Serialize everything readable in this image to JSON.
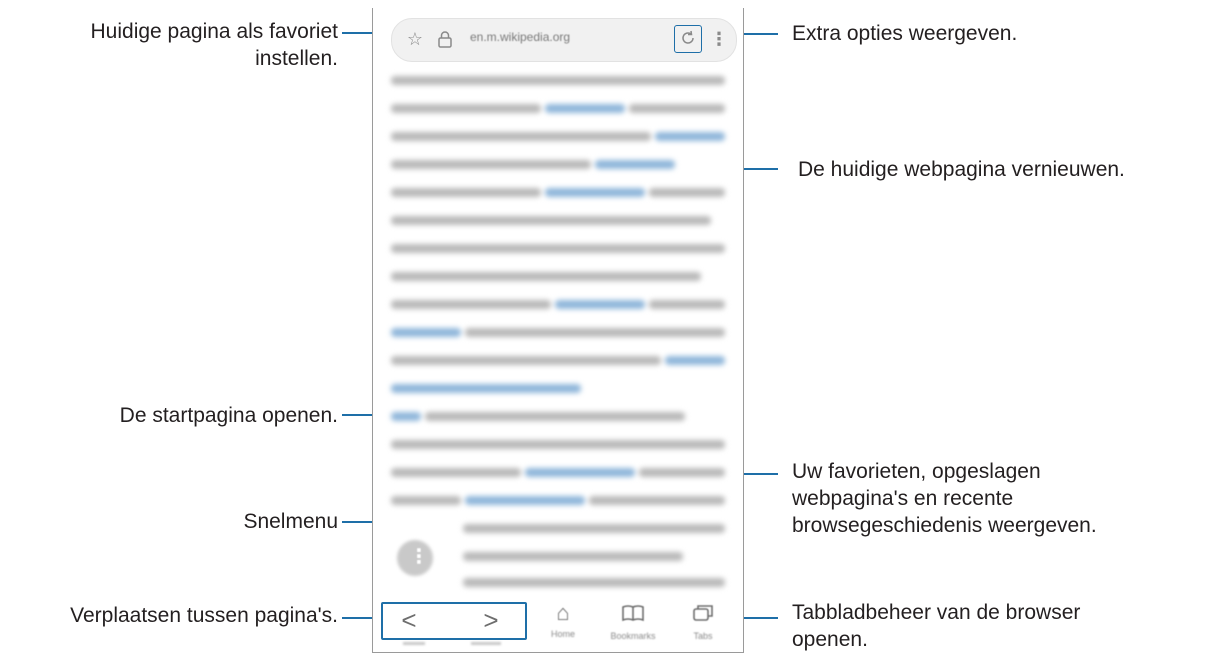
{
  "browser": {
    "url": "en.m.wikipedia.org",
    "toolbar": {
      "back": "<",
      "forward": ">",
      "home": "Home",
      "bookmarks": "Bookmarks",
      "tabs": "Tabs"
    }
  },
  "callouts": {
    "favorite": "Huidige pagina als favoriet",
    "favorite_line2": "instellen.",
    "more_options": "Extra opties weergeven.",
    "refresh": "De huidige webpagina vernieuwen.",
    "home": "De startpagina openen.",
    "bookmarks_line1": "Uw favorieten, opgeslagen",
    "bookmarks_line2": "webpagina's en recente",
    "bookmarks_line3": "browsegeschiedenis weergeven.",
    "quick_menu": "Snelmenu",
    "navigate": "Verplaatsen tussen pagina's.",
    "tabs_line1": "Tabbladbeheer van de browser",
    "tabs_line2": "openen."
  },
  "colors": {
    "accent_line": "#1e6fa8",
    "blurred_text": "#b9b9b9",
    "blurred_link": "#8fb6da"
  }
}
